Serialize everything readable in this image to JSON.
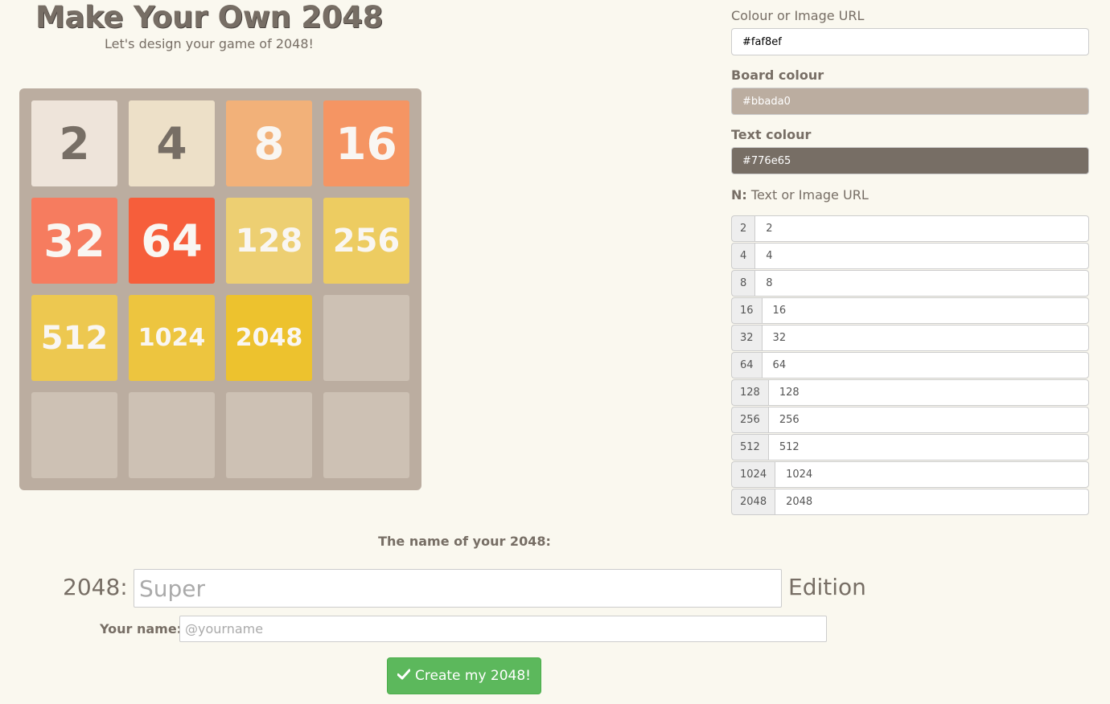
{
  "header": {
    "title": "Make Your Own 2048",
    "subtitle": "Let's design your game of 2048!"
  },
  "board": {
    "background_color": "#bbada0",
    "empty_cell_color": "#cdc1b4",
    "rows": [
      [
        {
          "label": "2",
          "bg": "#eee4da",
          "fg": "#776e65"
        },
        {
          "label": "4",
          "bg": "#ede0c8",
          "fg": "#776e65"
        },
        {
          "label": "8",
          "bg": "#f2b179",
          "fg": "#f9f6f2"
        },
        {
          "label": "16",
          "bg": "#f59563",
          "fg": "#f9f6f2"
        }
      ],
      [
        {
          "label": "32",
          "bg": "#f67c5f",
          "fg": "#f9f6f2"
        },
        {
          "label": "64",
          "bg": "#f65e3b",
          "fg": "#f9f6f2"
        },
        {
          "label": "128",
          "bg": "#edcf72",
          "fg": "#f9f6f2"
        },
        {
          "label": "256",
          "bg": "#edcc61",
          "fg": "#f9f6f2"
        }
      ],
      [
        {
          "label": "512",
          "bg": "#edc850",
          "fg": "#f9f6f2"
        },
        {
          "label": "1024",
          "bg": "#edc53f",
          "fg": "#f9f6f2"
        },
        {
          "label": "2048",
          "bg": "#edc22e",
          "fg": "#f9f6f2"
        },
        {
          "label": "",
          "bg": "#cdc1b4",
          "fg": "#776e65"
        }
      ],
      [
        {
          "label": "",
          "bg": "#cdc1b4",
          "fg": "#776e65"
        },
        {
          "label": "",
          "bg": "#cdc1b4",
          "fg": "#776e65"
        },
        {
          "label": "",
          "bg": "#cdc1b4",
          "fg": "#776e65"
        },
        {
          "label": "",
          "bg": "#cdc1b4",
          "fg": "#776e65"
        }
      ]
    ]
  },
  "settings": {
    "background_label": "Colour or Image URL",
    "background_value": "#faf8ef",
    "board_label": "Board colour",
    "board_value": "#bbada0",
    "text_label": "Text colour",
    "text_value": "#776e65",
    "tiles_label_prefix": "N:",
    "tiles_label": "Text or Image URL",
    "tiles": [
      {
        "n": "2",
        "value": "2"
      },
      {
        "n": "4",
        "value": "4"
      },
      {
        "n": "8",
        "value": "8"
      },
      {
        "n": "16",
        "value": "16"
      },
      {
        "n": "32",
        "value": "32"
      },
      {
        "n": "64",
        "value": "64"
      },
      {
        "n": "128",
        "value": "128"
      },
      {
        "n": "256",
        "value": "256"
      },
      {
        "n": "512",
        "value": "512"
      },
      {
        "n": "1024",
        "value": "1024"
      },
      {
        "n": "2048",
        "value": "2048"
      }
    ]
  },
  "naming": {
    "heading": "The name of your 2048:",
    "prefix": "2048:",
    "edition_placeholder": "Super",
    "suffix": "Edition",
    "your_name_label": "Your name:",
    "your_name_placeholder": "@yourname"
  },
  "create_button": {
    "label": "Create my 2048!",
    "icon": "check-icon",
    "color": "#5cb85c"
  }
}
